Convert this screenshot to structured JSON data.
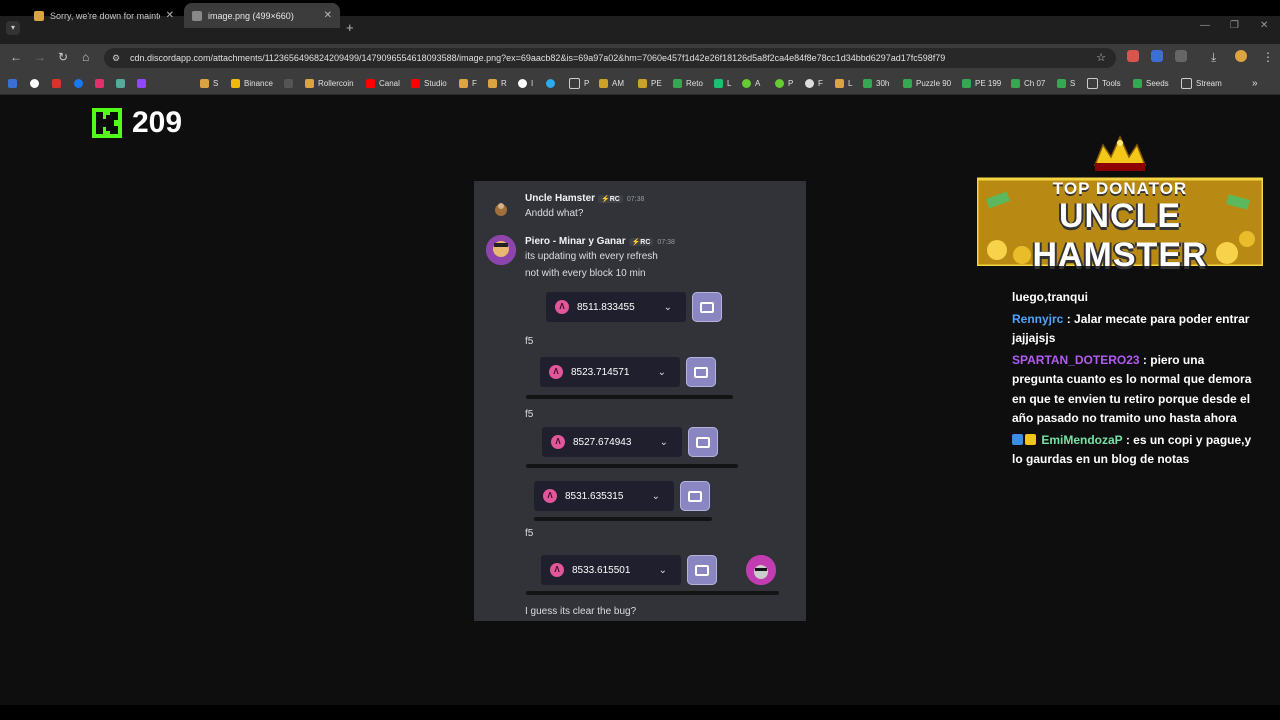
{
  "browser": {
    "tabs": [
      {
        "title": "Sorry, we're down for maintenan",
        "active": false
      },
      {
        "title": "image.png (499×660)",
        "active": true
      }
    ],
    "url": "cdn.discordapp.com/attachments/1123656496824209499/1479096554618093588/image.png?ex=69aacb82&is=69a97a02&hm=7060e457f1d42e26f18126d5a8f2ca4e84f8e78cc1d34bbd6297ad17fc598f79",
    "bookmarks": [
      "",
      "",
      "",
      "",
      "",
      "",
      "",
      "S",
      "Binance",
      "",
      "Rollercoin",
      "Canal",
      "Studio",
      "F",
      "R",
      "I",
      "",
      "P",
      "AM",
      "PE",
      "Reto",
      "L",
      "A",
      "P",
      "F",
      "L",
      "30h",
      "Puzzle 90",
      "PE 199",
      "Ch 07",
      "S",
      "Tools",
      "Seeds",
      "Stream"
    ]
  },
  "kick": {
    "viewer_count": "209"
  },
  "discord": {
    "messages": [
      {
        "author": "Uncle Hamster",
        "badge": "⚡RC",
        "time": "07:38",
        "lines": [
          "Anddd what?"
        ]
      },
      {
        "author": "Piero - Minar y Ganar",
        "badge": "⚡RC",
        "time": "07:38",
        "lines": [
          "its updating with every refresh",
          "not with every block 10 min"
        ]
      }
    ],
    "balances": [
      "8511.833455",
      "8523.714571",
      "8527.674943",
      "8531.635315",
      "8533.615501"
    ],
    "f5_labels": [
      "f5",
      "f5",
      "f5"
    ],
    "last_line": "I guess its clear the bug?"
  },
  "donator": {
    "line1": "TOP DONATOR",
    "line2": "UNCLE HAMSTER"
  },
  "chat": {
    "messages": [
      {
        "user": "",
        "text": "luego,tranqui"
      },
      {
        "user": "Rennyjrc",
        "text": ": Jalar mecate para poder entrar jajjajsjs"
      },
      {
        "user": "SPARTAN_DOTERO23",
        "text": ": piero una pregunta cuanto es lo normal que demora en que te envien tu retiro porque desde el año pasado no tramito uno hasta ahora"
      },
      {
        "user": "EmiMendozaP",
        "text": ": es un copi y pague,y lo gaurdas en un blog de notas"
      }
    ]
  },
  "colors": {
    "kick_green": "#53fc18",
    "discord_bg": "#313338",
    "coin_pink": "#e2569a"
  }
}
